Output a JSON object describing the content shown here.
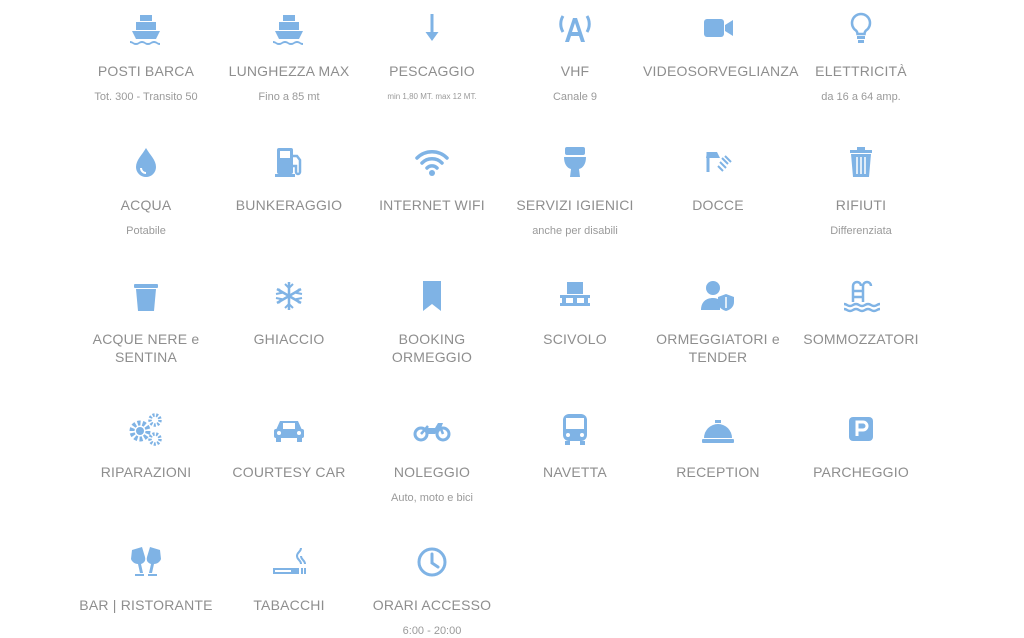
{
  "services": [
    {
      "title": "POSTI BARCA",
      "sub": "Tot. 300 - Transito 50",
      "icon": "ship-icon"
    },
    {
      "title": "LUNGHEZZA MAX",
      "sub": "Fino a 85 mt",
      "icon": "ship-icon"
    },
    {
      "title": "PESCAGGIO",
      "sub": "min 1,80 MT. max 12 MT.",
      "icon": "arrow-down-icon"
    },
    {
      "title": "VHF",
      "sub": "Canale 9",
      "icon": "antenna-icon"
    },
    {
      "title": "VIDEOSORVEGLIANZA",
      "sub": "",
      "icon": "video-camera-icon"
    },
    {
      "title": "ELETTRICITÀ",
      "sub": "da 16 a 64 amp.",
      "icon": "lightbulb-icon"
    },
    {
      "title": "ACQUA",
      "sub": "Potabile",
      "icon": "water-drop-icon"
    },
    {
      "title": "BUNKERAGGIO",
      "sub": "",
      "icon": "fuel-pump-icon"
    },
    {
      "title": "INTERNET WIFI",
      "sub": "",
      "icon": "wifi-icon"
    },
    {
      "title": "SERVIZI IGIENICI",
      "sub": "anche per disabili",
      "icon": "toilet-icon"
    },
    {
      "title": "DOCCE",
      "sub": "",
      "icon": "shower-icon"
    },
    {
      "title": "RIFIUTI",
      "sub": "Differenziata",
      "icon": "trash-can-icon"
    },
    {
      "title": "ACQUE NERE e SENTINA",
      "sub": "",
      "icon": "bin-icon"
    },
    {
      "title": "GHIACCIO",
      "sub": "",
      "icon": "snowflake-icon"
    },
    {
      "title": "BOOKING ORMEGGIO",
      "sub": "",
      "icon": "bookmark-icon"
    },
    {
      "title": "SCIVOLO",
      "sub": "",
      "icon": "pallet-icon"
    },
    {
      "title": "ORMEGGIATORI e TENDER",
      "sub": "",
      "icon": "user-shield-icon"
    },
    {
      "title": "SOMMOZZATORI",
      "sub": "",
      "icon": "swimming-pool-icon"
    },
    {
      "title": "RIPARAZIONI",
      "sub": "",
      "icon": "gears-icon"
    },
    {
      "title": "COURTESY CAR",
      "sub": "",
      "icon": "car-icon"
    },
    {
      "title": "NOLEGGIO",
      "sub": "Auto, moto e bici",
      "icon": "motorcycle-icon"
    },
    {
      "title": "NAVETTA",
      "sub": "",
      "icon": "bus-icon"
    },
    {
      "title": "RECEPTION",
      "sub": "",
      "icon": "concierge-bell-icon"
    },
    {
      "title": "PARCHEGGIO",
      "sub": "",
      "icon": "parking-icon"
    },
    {
      "title": "BAR | RISTORANTE",
      "sub": "",
      "icon": "glass-cheers-icon"
    },
    {
      "title": "TABACCHI",
      "sub": "",
      "icon": "smoking-icon"
    },
    {
      "title": "ORARI ACCESSO",
      "sub": "6:00 - 20:00",
      "icon": "clock-icon"
    }
  ],
  "colors": {
    "icon": "#7fb3e5",
    "text": "#8e8e8e"
  }
}
